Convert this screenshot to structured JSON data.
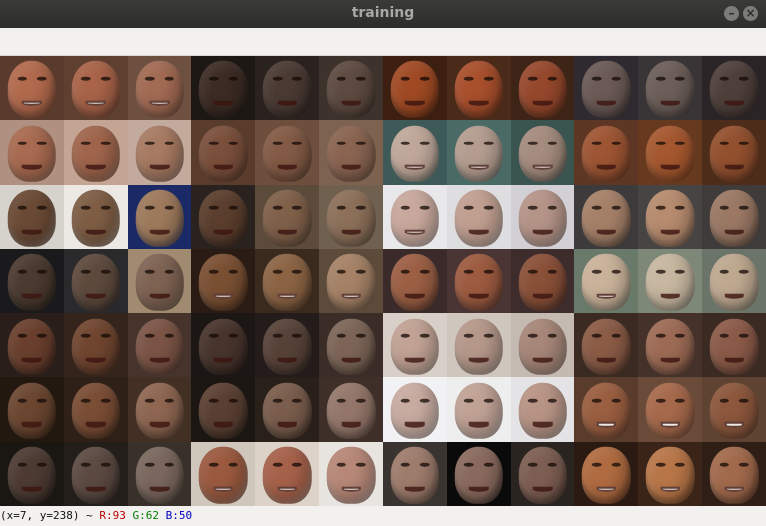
{
  "window": {
    "title": "training",
    "minimize_glyph": "–",
    "close_glyph": "×"
  },
  "status": {
    "coords": "(x=7, y=238) ~",
    "r": "R:93",
    "g": "G:62",
    "b": "B:50"
  },
  "grid": {
    "rows": 7,
    "cols": 12,
    "tiles": [
      [
        "#b26a4d",
        "#a86348",
        "#a16a53",
        "#3c2b24",
        "#4a3a33",
        "#5d4a40",
        "#a04a24",
        "#a84f2c",
        "#96482c",
        "#6b5a55",
        "#6c5e58",
        "#4e3f3a"
      ],
      [
        "#a86a50",
        "#9f644b",
        "#a77a62",
        "#7a4f3b",
        "#835a45",
        "#8a6451",
        "#bfa89a",
        "#b49d90",
        "#a48c7e",
        "#9d5533",
        "#a5582f",
        "#92502e"
      ],
      [
        "#6a4a35",
        "#7e5d44",
        "#9e7a5c",
        "#5b3e2d",
        "#7f6049",
        "#8c7059",
        "#c8a89c",
        "#c09f90",
        "#b59488",
        "#a58068",
        "#b68b6e",
        "#9a7864"
      ],
      [
        "#4b3a2f",
        "#5e4a3d",
        "#7e6353",
        "#7a5033",
        "#8c6444",
        "#a58266",
        "#9c5f44",
        "#9d5b40",
        "#8a5038",
        "#c9b29a",
        "#c7b7a0",
        "#bea890"
      ],
      [
        "#6a3f2d",
        "#70452f",
        "#7b5446",
        "#47342c",
        "#574238",
        "#7c6557",
        "#c1a294",
        "#b5988a",
        "#a68678",
        "#8a5b45",
        "#9d6b55",
        "#8b5a48"
      ],
      [
        "#6b4630",
        "#7a4d35",
        "#8e6651",
        "#5a4032",
        "#7a5d4c",
        "#94776a",
        "#c7aba0",
        "#c0a295",
        "#b89485",
        "#9a5e40",
        "#a6694b",
        "#8c573c"
      ],
      [
        "#4d3b33",
        "#5c4a42",
        "#7a675d",
        "#9b5a3f",
        "#a6614a",
        "#b78878",
        "#9e7c6c",
        "#8a6a5e",
        "#7d5e52",
        "#b06b40",
        "#b87648",
        "#a26a4c"
      ]
    ],
    "smiles": [
      [
        true,
        true,
        true,
        false,
        false,
        false,
        false,
        false,
        false,
        false,
        false,
        false
      ],
      [
        false,
        false,
        false,
        false,
        false,
        false,
        true,
        true,
        true,
        false,
        false,
        false
      ],
      [
        false,
        false,
        false,
        false,
        false,
        false,
        true,
        false,
        false,
        false,
        false,
        false
      ],
      [
        false,
        false,
        false,
        true,
        true,
        true,
        false,
        false,
        false,
        true,
        false,
        false
      ],
      [
        false,
        false,
        false,
        false,
        false,
        false,
        false,
        false,
        false,
        false,
        false,
        false
      ],
      [
        false,
        false,
        false,
        false,
        false,
        false,
        false,
        false,
        false,
        true,
        true,
        true
      ],
      [
        false,
        false,
        false,
        true,
        true,
        true,
        false,
        false,
        false,
        true,
        true,
        true
      ]
    ],
    "backgrounds": [
      [
        "#5a3a2c",
        "#5e3f30",
        "#6d5040",
        "#1e1814",
        "#2a221e",
        "#3e332c",
        "#3c1f10",
        "#4a2a18",
        "#3d2416",
        "#2e2a30",
        "#393436",
        "#2a2426"
      ],
      [
        "#b09080",
        "#c4a493",
        "#c2aa9c",
        "#5a3c2c",
        "#6e4e3c",
        "#7e6250",
        "#3e5a58",
        "#4a6a66",
        "#3a5450",
        "#5e3624",
        "#67391f",
        "#4e2c1a"
      ],
      [
        "#d6d2cc",
        "#ece8e4",
        "#1b2a66",
        "#2a221e",
        "#5c4a3a",
        "#706050",
        "#e8e8ea",
        "#dedde0",
        "#d2d0d4",
        "#3c3a3a",
        "#474444",
        "#3e3b3a"
      ],
      [
        "#1a1a1c",
        "#2a2a2c",
        "#a08a70",
        "#2a1c14",
        "#3a2a1e",
        "#5c4a3a",
        "#3a2a2a",
        "#4a3434",
        "#3e2c2c",
        "#6a7a6a",
        "#7e8878",
        "#6a7468"
      ],
      [
        "#2a1e1a",
        "#34241c",
        "#46342c",
        "#1c1614",
        "#241c1a",
        "#3a2c26",
        "#d8d0c8",
        "#cfc6be",
        "#c4bab2",
        "#3a2a22",
        "#44322a",
        "#3a2a22"
      ],
      [
        "#221810",
        "#2e2016",
        "#423024",
        "#1c1612",
        "#2a201a",
        "#3e3028",
        "#f2f2f4",
        "#eeeeef",
        "#e4e4e6",
        "#5a3c2c",
        "#6a4a38",
        "#5e4232"
      ],
      [
        "#1a1612",
        "#241e1a",
        "#38302a",
        "#cfc6bc",
        "#dcd2c8",
        "#e8e4e0",
        "#3a3430",
        "#0a0a0a",
        "#2a2420",
        "#2a1a12",
        "#3a2418",
        "#2e1e16"
      ]
    ]
  }
}
